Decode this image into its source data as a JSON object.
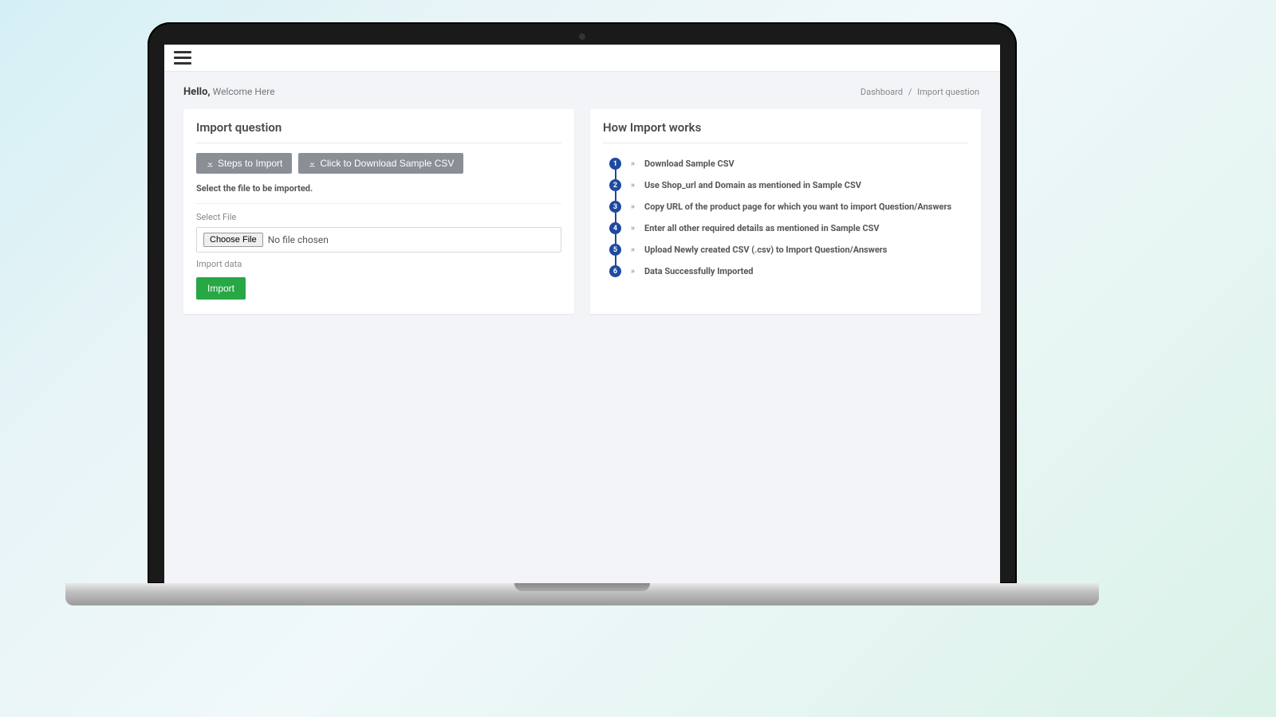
{
  "greeting": {
    "hello": "Hello,",
    "sub": "Welcome Here"
  },
  "breadcrumb": {
    "root": "Dashboard",
    "sep": "/",
    "current": "Import question"
  },
  "left": {
    "title": "Import question",
    "btn_steps": "Steps to Import",
    "btn_download": "Click to Download Sample CSV",
    "instruction": "Select the file to be imported.",
    "select_file_label": "Select File",
    "choose_file": "Choose File",
    "no_file": "No file chosen",
    "import_data_label": "Import data",
    "import_btn": "Import"
  },
  "right": {
    "title": "How Import works",
    "steps": [
      "Download Sample CSV",
      "Use Shop_url and Domain as mentioned in Sample CSV",
      "Copy URL of the product page for which you want to import Question/Answers",
      "Enter all other required details as mentioned in Sample CSV",
      "Upload Newly created CSV (.csv) to Import Question/Answers",
      "Data Successfully Imported"
    ]
  }
}
